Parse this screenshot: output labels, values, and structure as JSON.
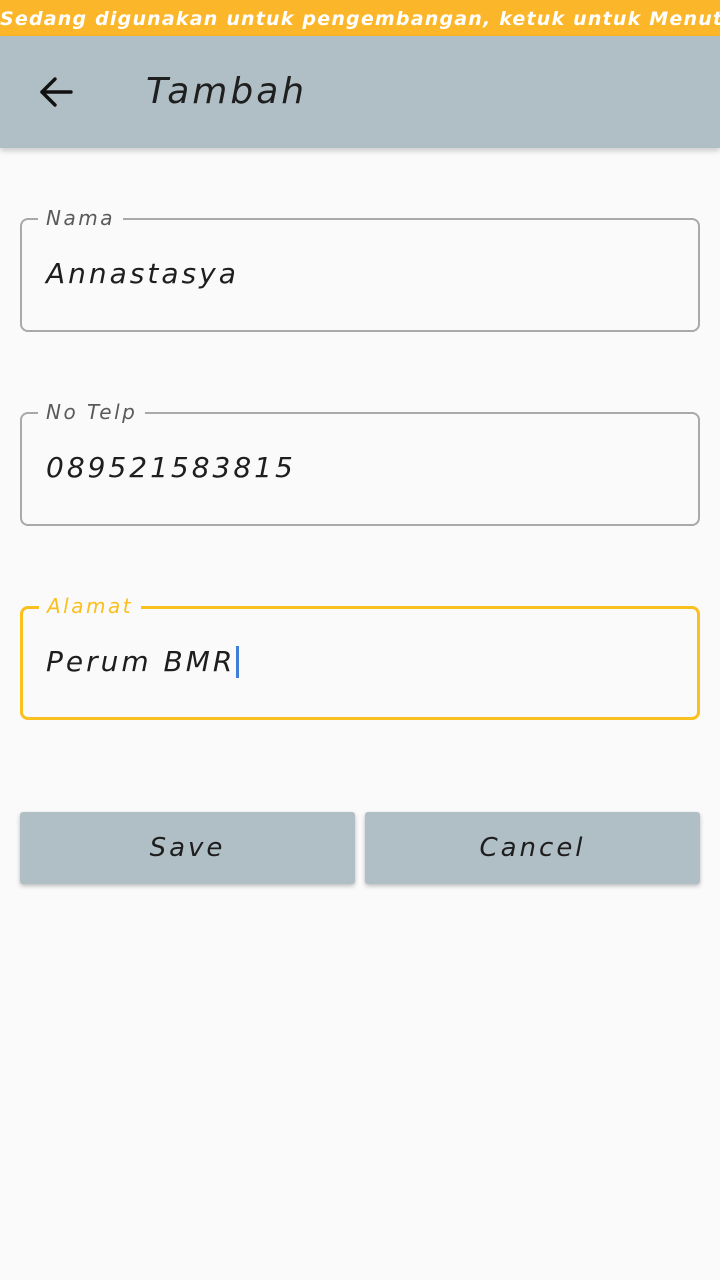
{
  "dev_banner": {
    "text": "Sedang digunakan untuk pengembangan, ketuk untuk Menutup"
  },
  "appbar": {
    "back_icon": "arrow-left-icon",
    "title": "Tambah",
    "background": "#b0bec5"
  },
  "form": {
    "nama": {
      "label": "Nama",
      "value": "Annastasya"
    },
    "telp": {
      "label": "No Telp",
      "value": "089521583815"
    },
    "alamat": {
      "label": "Alamat",
      "value": "Perum BMR",
      "focused": true
    }
  },
  "buttons": {
    "save_label": "Save",
    "cancel_label": "Cancel"
  },
  "colors": {
    "accent": "#f9c01f",
    "banner": "#fbb629",
    "button": "#b0bec5",
    "caret": "#3f7fd6"
  }
}
